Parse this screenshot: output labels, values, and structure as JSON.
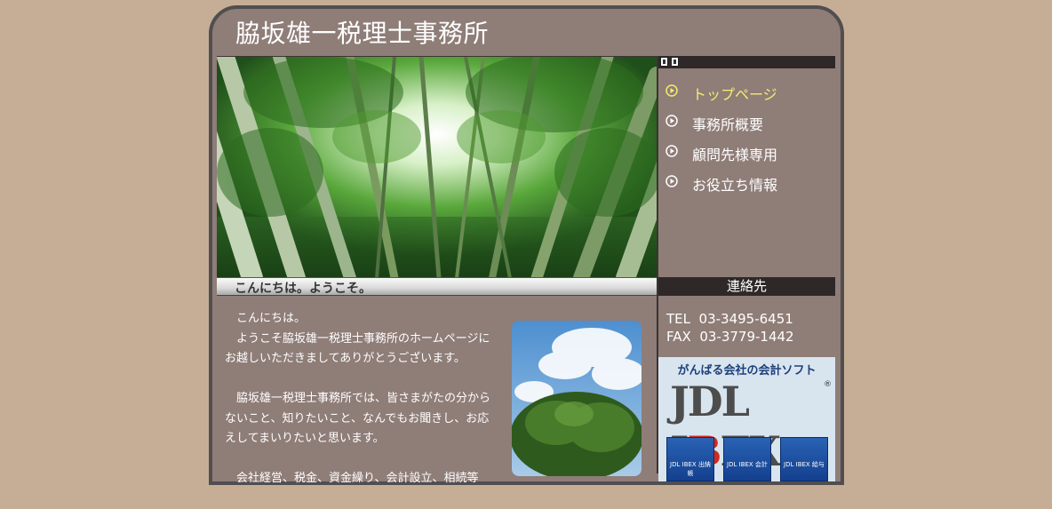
{
  "site": {
    "title": "脇坂雄一税理士事務所"
  },
  "hero": {
    "alt": "bamboo-forest-photo"
  },
  "welcome_bar": {
    "text": "こんにちは。ようこそ。"
  },
  "nav": {
    "items": [
      {
        "label": "トップページ",
        "active": true
      },
      {
        "label": "事務所概要",
        "active": false
      },
      {
        "label": "顧問先様専用",
        "active": false
      },
      {
        "label": "お役立ち情報",
        "active": false
      }
    ]
  },
  "contact": {
    "header": "連絡先",
    "tel": "TEL  03-3495-6451",
    "fax": "FAX  03-3779-1442"
  },
  "banner": {
    "tagline": "がんばる会社の会計ソフト",
    "logo_a": "JDL I",
    "logo_b": "B",
    "logo_c": "EX",
    "reg": "®",
    "box1": "JDL IBEX 出納帳",
    "box2": "JDL IBEX 会計",
    "box3": "JDL IBEX 給与"
  },
  "main": {
    "p1": "　こんにちは。",
    "p1b": "　ようこそ脇坂雄一税理士事務所のホームページにお越しいただきましてありがとうございます。",
    "p2": "　脇坂雄一税理士事務所では、皆さまがたの分からないこと、知りたいこと、なんでもお聞きし、お応えしてまいりたいと思います。",
    "p3": "　会社経営、税金、資金繰り、会計設立、相続等"
  },
  "colors": {
    "page_bg": "#c6ae96",
    "panel_bg": "#8f7d78",
    "dark_bar": "#2e2928",
    "active_nav": "#f5ec70"
  }
}
